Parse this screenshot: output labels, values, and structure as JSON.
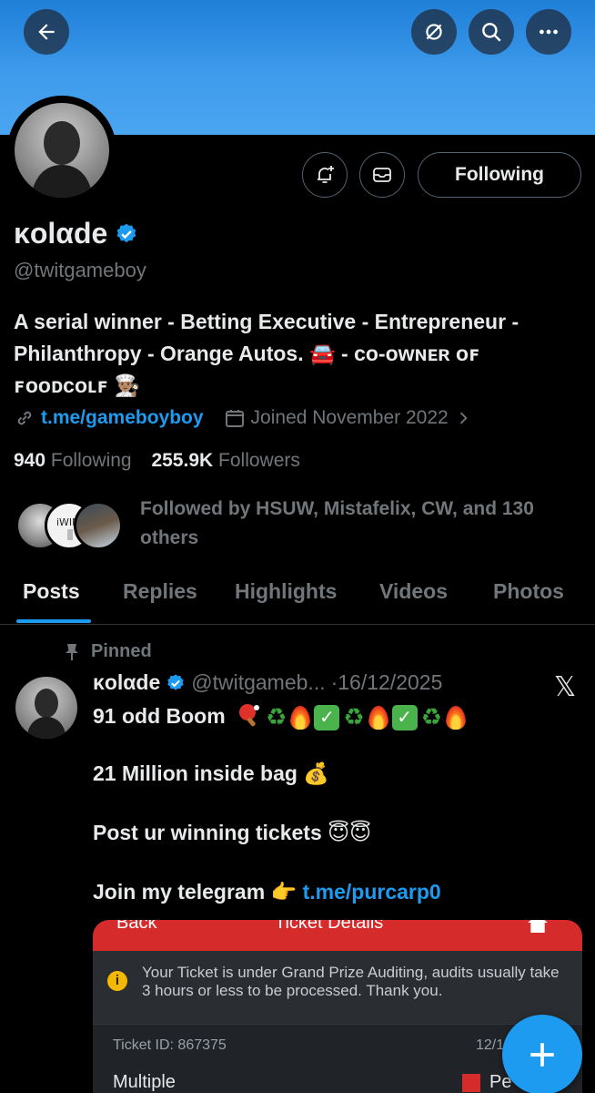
{
  "profile": {
    "name": "κolαde",
    "handle": "@twitgameboy",
    "bio_line1": "A serial winner - Betting Executive - Entrepreneur -",
    "bio_line2": "Philanthropy - Orange Autos. 🚘 - ᴄᴏ-ᴏᴡɴᴇʀ ᴏꜰ",
    "bio_line3": "ꜰᴏᴏᴅᴄᴏʟꜰ 👨🏽‍🍳",
    "link": "t.me/gameboyboy",
    "joined": "Joined November 2022",
    "following_count": "940",
    "following_label": "Following",
    "followers_count": "255.9K",
    "followers_label": "Followers",
    "followed_by": "Followed by HSUW, Mistafelix, CW, and 130 others",
    "follow_button": "Following",
    "verified_color": "#1d9bf0"
  },
  "tabs": [
    "Posts",
    "Replies",
    "Highlights",
    "Videos",
    "Photos"
  ],
  "post": {
    "pinned_label": "Pinned",
    "author": "κolαde",
    "handle": "@twitgameb...",
    "date": "·16/12/2025",
    "line1": "91 odd Boom",
    "line2": "21 Million inside bag 💰",
    "line3": "Post ur winning tickets 😇😇",
    "line4_text": "Join my telegram 👉",
    "line4_link": "t.me/purcarp0",
    "platform_logo": "𝕏"
  },
  "ticket": {
    "back": "Back",
    "title": "Ticket Details",
    "notice": "Your Ticket is under Grand Prize Auditing, audits usually take 3 hours or less to be processed. Thank you.",
    "ticket_id": "Ticket ID: 867375",
    "date_partial": "12/1",
    "type": "Multiple",
    "status_partial": "Pe"
  },
  "icons": {
    "back": "arrow-left-icon",
    "hide": "eye-slash-icon",
    "search": "search-icon",
    "more": "more-icon",
    "notify": "bell-plus-icon",
    "message": "envelope-icon",
    "link": "link-icon",
    "calendar": "calendar-icon",
    "pin": "pin-icon",
    "compose": "plus-icon"
  }
}
